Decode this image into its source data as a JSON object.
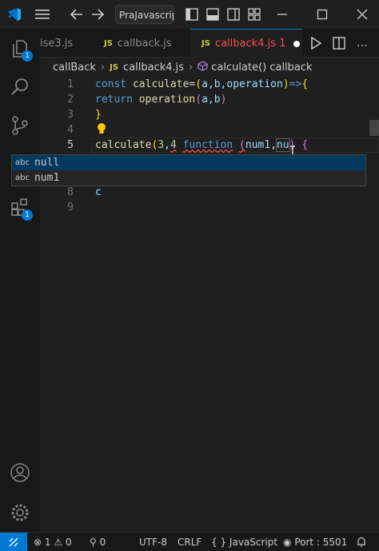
{
  "titlebar": {
    "search_text": "PraJavascript"
  },
  "activity": {
    "explorer_badge": "1",
    "extensions_badge": "1"
  },
  "tabs": [
    {
      "label": "ise3.js"
    },
    {
      "label": "callback.js",
      "badge": "JS"
    },
    {
      "label": "callback4.js 1",
      "badge": "JS",
      "active": true
    }
  ],
  "breadcrumbs": {
    "folder": "callBack",
    "file": "callback4.js",
    "file_badge": "JS",
    "symbol": "calculate() callback"
  },
  "editor": {
    "line_numbers": [
      "1",
      "2",
      "3",
      "4",
      "5",
      "8",
      "9"
    ],
    "line1": {
      "kw": "const",
      "name": "calculate",
      "eq": "=",
      "paren_open": "(",
      "params": "a,b,operation",
      "paren_close": ")",
      "arrow": "=>",
      "brace": "{"
    },
    "line2": {
      "kw": "return",
      "call": "operation",
      "args_open": "(",
      "args": "a,b",
      "args_close": ")"
    },
    "line3": {
      "brace": "}"
    },
    "line5": {
      "call": "calculate",
      "open": "(",
      "n1": "3",
      "comma1": ",",
      "n2": "4",
      "kw": "function",
      "p_open": "(",
      "p1": "num1",
      "comma2": ",",
      "p2": "nu",
      "p_close": ")",
      "brace": "{"
    },
    "line8": {
      "text": "c"
    }
  },
  "suggest": {
    "items": [
      {
        "kind": "abc",
        "label": "null"
      },
      {
        "kind": "abc",
        "label": "num1"
      }
    ]
  },
  "statusbar": {
    "errors": "1",
    "warnings": "0",
    "ports": "0",
    "encoding": "UTF-8",
    "eol": "CRLF",
    "language_braces": "{ }",
    "language": "JavaScript",
    "port": "Port : 5501"
  },
  "colors": {
    "accent": "#0078d4",
    "error": "#f14c4c",
    "js_badge": "#cbcb41"
  }
}
